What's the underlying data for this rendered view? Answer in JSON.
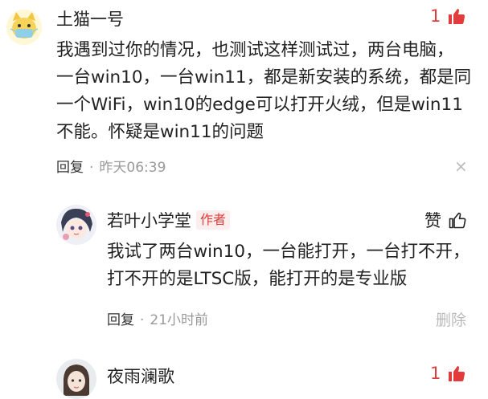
{
  "colors": {
    "accent": "#e33b3b",
    "muted": "#999999",
    "text": "#222222"
  },
  "comments": [
    {
      "author": "土猫一号",
      "avatar_icon": "cat-avatar-icon",
      "likes": "1",
      "lines": [
        "我遇到过你的情况，也测试这样测试过，两台电脑，",
        "一台win10，一台win11，都是新安装的系统，都是同",
        "一个WiFi，win10的edge可以打开火绒，但是win11",
        "不能。怀疑是win11的问题"
      ],
      "reply_label": "回复",
      "separator": "·",
      "time": "昨天06:39",
      "close_symbol": "×"
    },
    {
      "author": "若叶小学堂",
      "badge": "作者",
      "avatar_icon": "anime-avatar-icon",
      "like_label": "赞",
      "lines": [
        "我试了两台win10，一台能打开，一台打不开，",
        "打不开的是LTSC版，能打开的是专业版"
      ],
      "reply_label": "回复",
      "separator": "·",
      "time": "21小时前",
      "delete_label": "删除"
    },
    {
      "author": "夜雨澜歌",
      "avatar_icon": "girl-avatar-icon",
      "likes": "1"
    }
  ]
}
